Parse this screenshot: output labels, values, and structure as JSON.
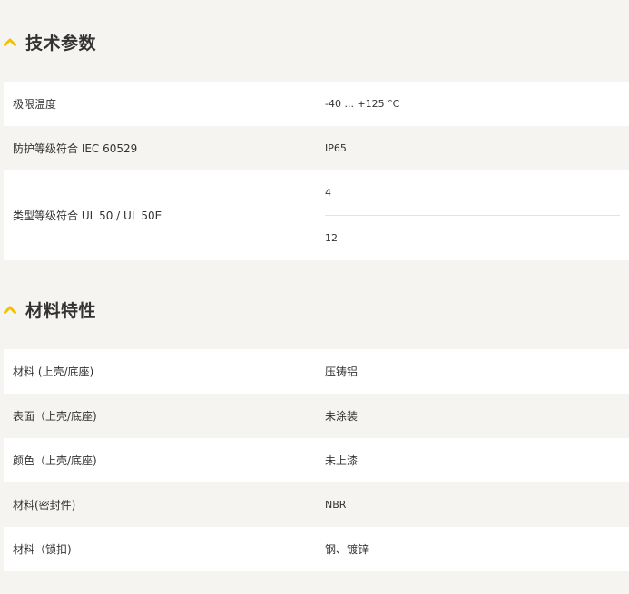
{
  "sections": [
    {
      "title": "技术参数",
      "rows": [
        {
          "label": "极限温度",
          "value": "-40 ... +125 °C"
        },
        {
          "label": "防护等级符合 IEC 60529",
          "value": "IP65"
        },
        {
          "label": "类型等级符合 UL 50 / UL 50E",
          "values": [
            "4",
            "12"
          ]
        }
      ]
    },
    {
      "title": "材料特性",
      "rows": [
        {
          "label": "材料 (上壳/底座)",
          "value": "压铸铝"
        },
        {
          "label": "表面（上壳/底座)",
          "value": "未涂装"
        },
        {
          "label": "颜色（上壳/底座)",
          "value": "未上漆"
        },
        {
          "label": "材料(密封件)",
          "value": "NBR"
        },
        {
          "label": "材料（锁扣)",
          "value": "钢、镀锌"
        }
      ]
    }
  ],
  "colors": {
    "accent": "#f2c200",
    "page_bg": "#f5f4f0",
    "row_white": "#ffffff",
    "text": "#333333"
  },
  "icons": {
    "section_toggle": "chevron-up-icon"
  }
}
